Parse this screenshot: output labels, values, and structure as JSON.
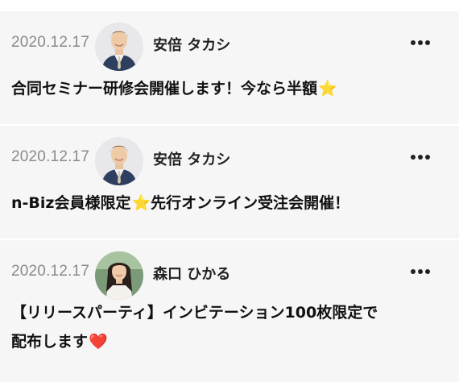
{
  "posts": [
    {
      "date": "2020.12.17",
      "author": "安倍 タカシ",
      "avatar": "man-in-suit-photo",
      "text": "合同セミナー研修会開催します！今なら半額",
      "emoji": "⭐",
      "emoji_name": "star-icon"
    },
    {
      "date": "2020.12.17",
      "author": "安倍 タカシ",
      "avatar": "man-in-suit-photo",
      "text_before": "n-Biz会員様限定",
      "emoji": "⭐",
      "emoji_name": "star-icon",
      "text_after": "先行オンライン受注会開催！"
    },
    {
      "date": "2020.12.17",
      "author": "森口 ひかる",
      "avatar": "woman-portrait-photo",
      "text_line1": "【リリースパーティ】インビテーション100枚限定で",
      "text_line2": "配布します",
      "emoji": "❤️",
      "emoji_name": "heart-icon"
    }
  ],
  "more_icon": "more-horizontal-icon",
  "colors": {
    "card_background": "#f6f6f6",
    "date_text": "#8a8a8a",
    "star": "#f5c20a",
    "heart": "#e0302a"
  }
}
